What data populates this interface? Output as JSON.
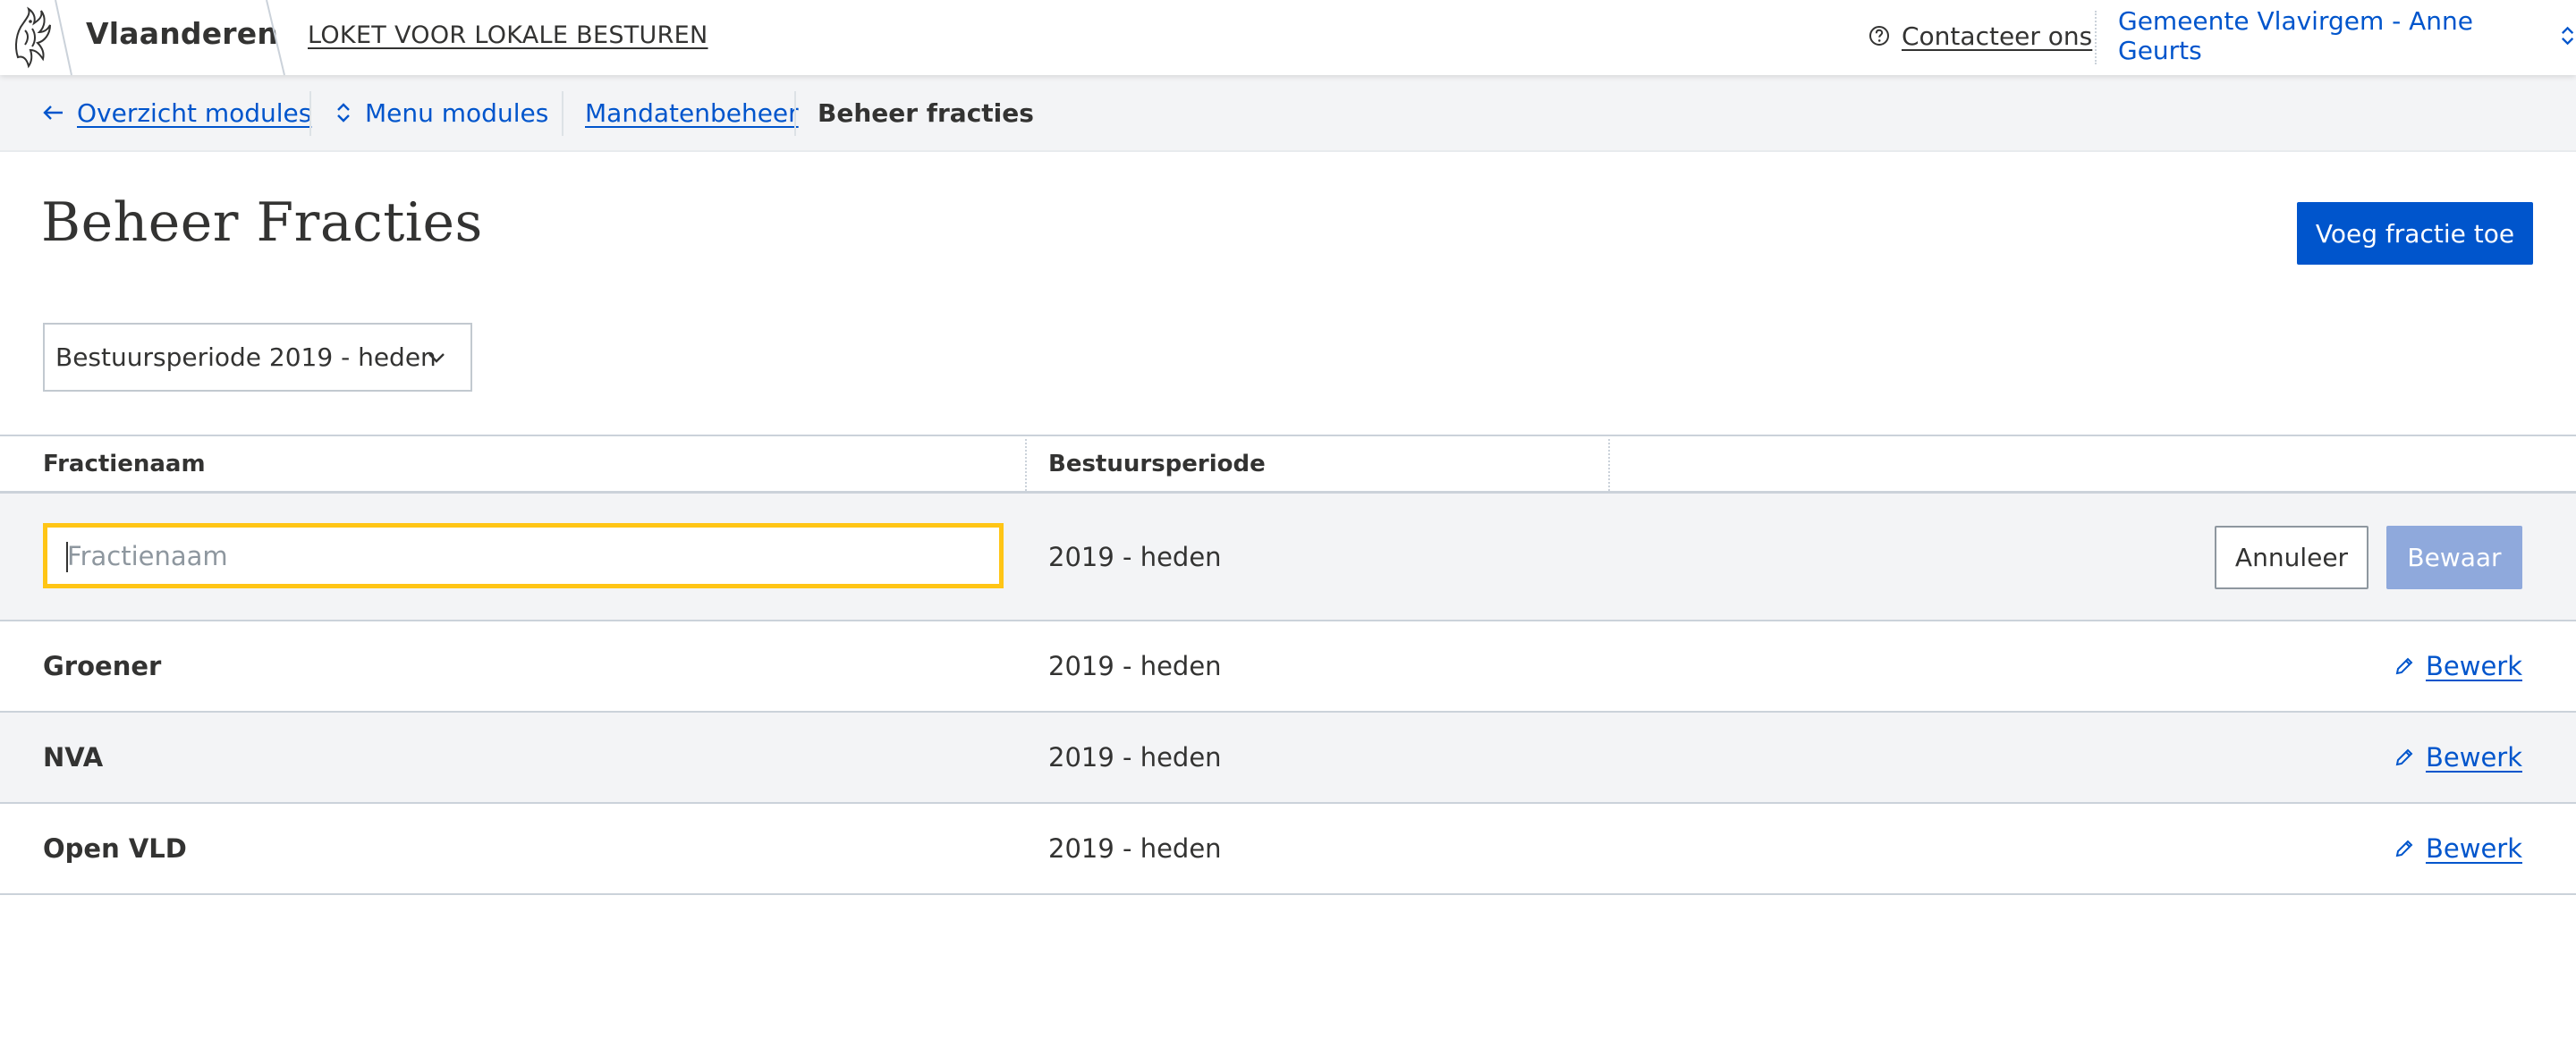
{
  "header": {
    "brand": "Vlaanderen",
    "app_title": "LOKET VOOR LOKALE BESTUREN",
    "contact_label": "Contacteer ons",
    "profile_label": "Gemeente Vlavirgem - Anne Geurts"
  },
  "subnav": {
    "back_label": "Overzicht modules",
    "menu_label": "Menu modules",
    "breadcrumb_parent": "Mandatenbeheer",
    "breadcrumb_current": "Beheer fracties"
  },
  "page": {
    "title": "Beheer Fracties",
    "add_button_label": "Voeg fractie toe",
    "period_select_value": "Bestuursperiode 2019 - heden"
  },
  "table": {
    "columns": [
      "Fractienaam",
      "Bestuursperiode",
      ""
    ],
    "edit_row": {
      "name_placeholder": "Fractienaam",
      "name_value": "",
      "period": "2019 - heden",
      "cancel_label": "Annuleer",
      "save_label": "Bewaar"
    },
    "rows": [
      {
        "name": "Groener",
        "period": "2019 - heden",
        "action": "Bewerk"
      },
      {
        "name": "NVA",
        "period": "2019 - heden",
        "action": "Bewerk"
      },
      {
        "name": "Open VLD",
        "period": "2019 - heden",
        "action": "Bewerk"
      }
    ]
  },
  "icons": {
    "logo": "flemish-lion-icon",
    "contact": "question-circle-icon",
    "profile": "chevron-up-down-icon",
    "back": "arrow-left-icon",
    "menu": "chevron-up-down-icon",
    "period_select": "chevron-down-icon",
    "edit": "pencil-icon"
  },
  "colors": {
    "link": "#0055cc",
    "primary_button": "#0055cc",
    "disabled_button": "#8fa9dc",
    "focus_border": "#ffc515",
    "subnav_background": "#f3f4f6",
    "text": "#333332"
  }
}
